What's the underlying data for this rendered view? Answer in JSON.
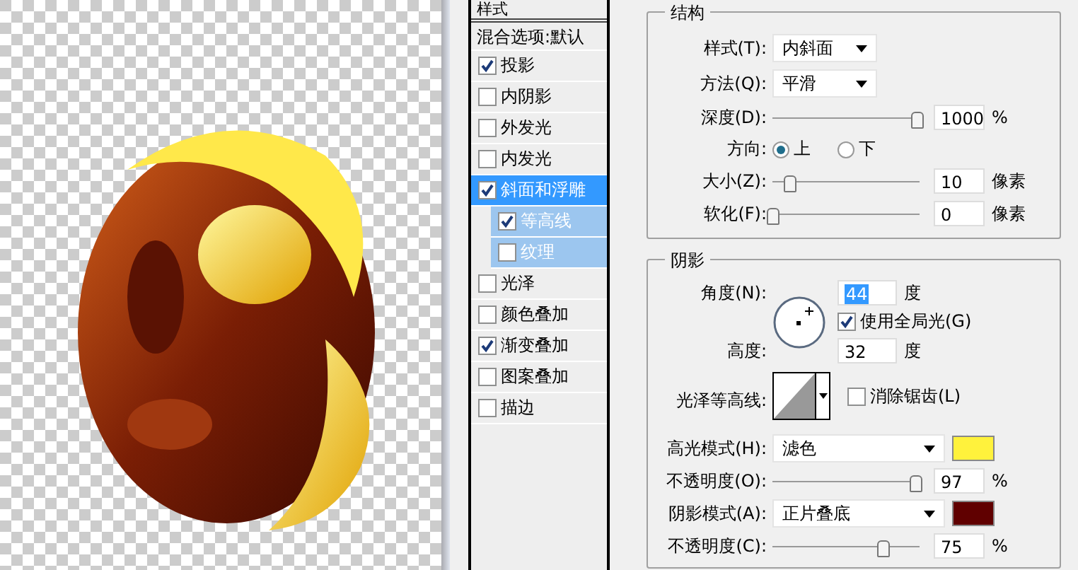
{
  "styles_header": "样式",
  "blend_options": "混合选项:默认",
  "style_items": [
    {
      "label": "投影",
      "checked": true,
      "selected": false
    },
    {
      "label": "内阴影",
      "checked": false,
      "selected": false
    },
    {
      "label": "外发光",
      "checked": false,
      "selected": false
    },
    {
      "label": "内发光",
      "checked": false,
      "selected": false
    },
    {
      "label": "斜面和浮雕",
      "checked": true,
      "selected": true,
      "children": [
        {
          "label": "等高线",
          "checked": true,
          "selected": false
        },
        {
          "label": "纹理",
          "checked": false,
          "selected": false
        }
      ]
    },
    {
      "label": "光泽",
      "checked": false,
      "selected": false
    },
    {
      "label": "颜色叠加",
      "checked": false,
      "selected": false
    },
    {
      "label": "渐变叠加",
      "checked": true,
      "selected": false
    },
    {
      "label": "图案叠加",
      "checked": false,
      "selected": false
    },
    {
      "label": "描边",
      "checked": false,
      "selected": false
    }
  ],
  "structure": {
    "title": "结构",
    "rows": [
      {
        "kind": "select",
        "label": "样式(T):",
        "value": "内斜面"
      },
      {
        "kind": "select",
        "label": "方法(Q):",
        "value": "平滑"
      },
      {
        "kind": "slider",
        "label": "深度(D):",
        "level": 0.98,
        "value": "1000",
        "unit": "%"
      },
      {
        "kind": "radio",
        "label": "方向:",
        "options": [
          {
            "label": "上",
            "selected": true
          },
          {
            "label": "下",
            "selected": false
          }
        ]
      },
      {
        "kind": "slider",
        "label": "大小(Z):",
        "level": 0.12,
        "value": "10",
        "unit": "像素"
      },
      {
        "kind": "slider",
        "label": "软化(F):",
        "level": 0,
        "value": "0",
        "unit": "像素"
      }
    ]
  },
  "shading": {
    "title": "阴影",
    "angle_label": "角度(N):",
    "angle": "44",
    "angle_unit": "度",
    "global_light": {
      "label": "使用全局光(G)",
      "checked": true
    },
    "altitude_label": "高度:",
    "altitude": "32",
    "altitude_unit": "度",
    "gloss_label": "光泽等高线:",
    "antialias": {
      "label": "消除锯齿(L)",
      "checked": false
    },
    "rows": [
      {
        "kind": "mode",
        "label": "高光模式(H):",
        "value": "滤色",
        "color": "#fff23c"
      },
      {
        "kind": "slider",
        "label": "不透明度(O):",
        "level": 0.97,
        "value": "97",
        "unit": "%"
      },
      {
        "kind": "mode",
        "label": "阴影模式(A):",
        "value": "正片叠底",
        "color": "#600000"
      },
      {
        "kind": "slider",
        "label": "不透明度(C):",
        "level": 0.75,
        "value": "75",
        "unit": "%"
      }
    ]
  }
}
